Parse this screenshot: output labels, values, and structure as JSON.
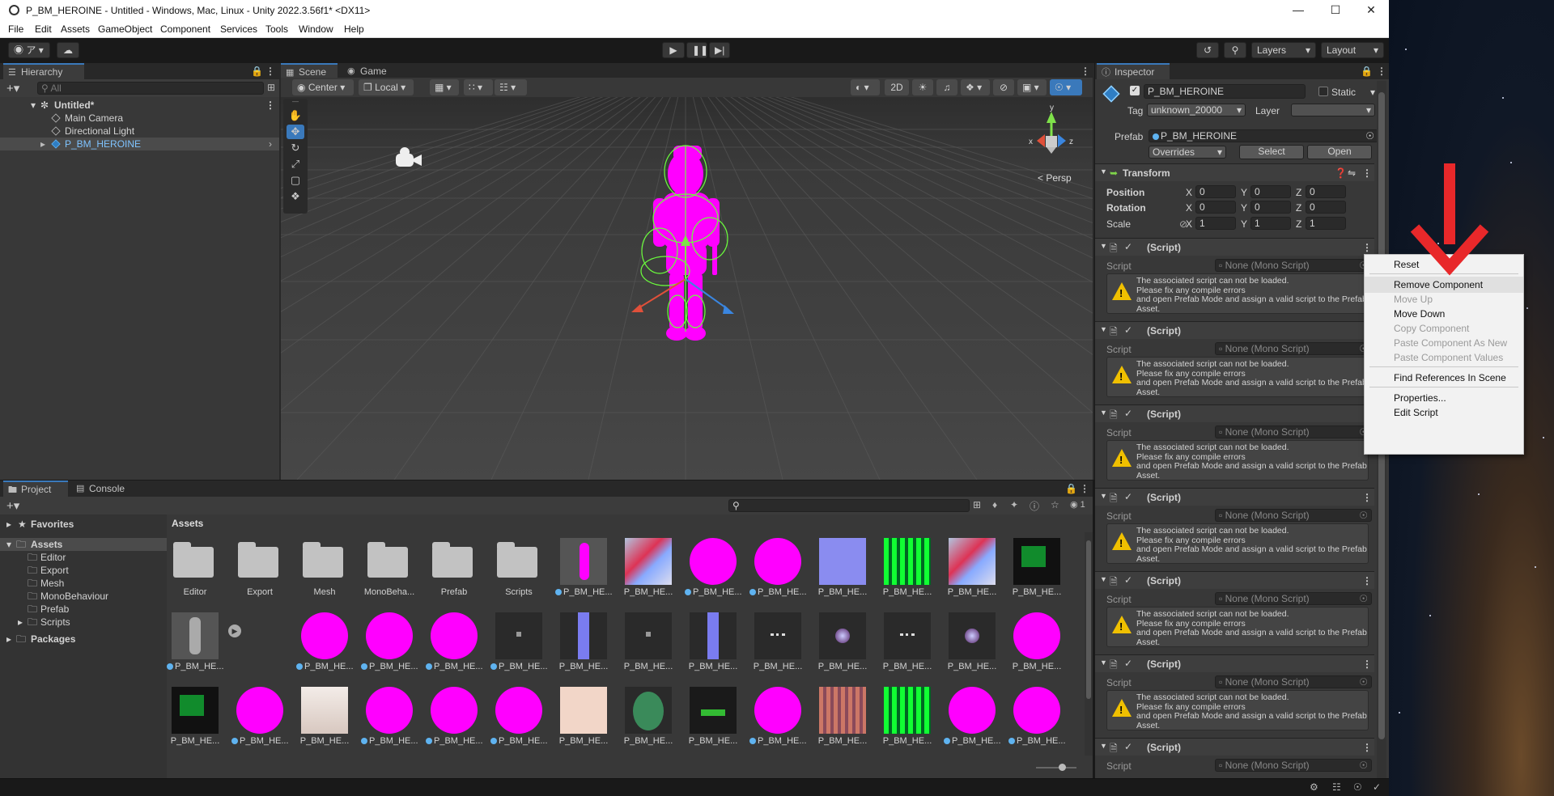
{
  "window": {
    "title": "P_BM_HEROINE - Untitled - Windows, Mac, Linux - Unity 2022.3.56f1* <DX11>"
  },
  "menu": [
    "File",
    "Edit",
    "Assets",
    "GameObject",
    "Component",
    "Services",
    "Tools",
    "Window",
    "Help"
  ],
  "toolbar": {
    "account_label": "ア",
    "layers_label": "Layers",
    "layout_label": "Layout"
  },
  "hierarchy": {
    "tab": "Hierarchy",
    "search_placeholder": "All",
    "scene_name": "Untitled*",
    "items": [
      "Main Camera",
      "Directional Light",
      "P_BM_HEROINE"
    ]
  },
  "scene": {
    "tabs": [
      "Scene",
      "Game"
    ],
    "pivot": "Center",
    "space": "Local",
    "mode_2d": "2D",
    "persp_label": "Persp",
    "axes": [
      "y",
      "x",
      "z"
    ]
  },
  "inspector": {
    "tab": "Inspector",
    "object_name": "P_BM_HEROINE",
    "static_label": "Static",
    "tag_label": "Tag",
    "tag_value": "unknown_20000",
    "layer_label": "Layer",
    "layer_value": "",
    "prefab_label": "Prefab",
    "prefab_value": "P_BM_HEROINE",
    "overrides_label": "Overrides",
    "select_label": "Select",
    "open_label": "Open",
    "transform": {
      "title": "Transform",
      "position_label": "Position",
      "rotation_label": "Rotation",
      "scale_label": "Scale",
      "axis_labels": [
        "X",
        "Y",
        "Z"
      ],
      "position": [
        "0",
        "0",
        "0"
      ],
      "rotation": [
        "0",
        "0",
        "0"
      ],
      "scale": [
        "1",
        "1",
        "1"
      ]
    },
    "components": [
      {
        "title": "(Script)",
        "script_label": "Script",
        "script_value": "None (Mono Script)",
        "warning": "The associated script can not be loaded.\nPlease fix any compile errors\nand open Prefab Mode and assign a valid script to the Prefab\nAsset."
      },
      {
        "title": "(Script)",
        "script_label": "Script",
        "script_value": "None (Mono Script)",
        "warning": "The associated script can not be loaded.\nPlease fix any compile errors\nand open Prefab Mode and assign a valid script to the Prefab\nAsset."
      },
      {
        "title": "(Script)",
        "script_label": "Script",
        "script_value": "None (Mono Script)",
        "warning": "The associated script can not be loaded.\nPlease fix any compile errors\nand open Prefab Mode and assign a valid script to the Prefab\nAsset."
      },
      {
        "title": "(Script)",
        "script_label": "Script",
        "script_value": "None (Mono Script)",
        "warning": "The associated script can not be loaded.\nPlease fix any compile errors\nand open Prefab Mode and assign a valid script to the Prefab\nAsset."
      },
      {
        "title": "(Script)",
        "script_label": "Script",
        "script_value": "None (Mono Script)",
        "warning": "The associated script can not be loaded.\nPlease fix any compile errors\nand open Prefab Mode and assign a valid script to the Prefab\nAsset."
      },
      {
        "title": "(Script)",
        "script_label": "Script",
        "script_value": "None (Mono Script)",
        "warning": "The associated script can not be loaded.\nPlease fix any compile errors\nand open Prefab Mode and assign a valid script to the Prefab\nAsset."
      },
      {
        "title": "(Script)",
        "script_label": "Script",
        "script_value": "None (Mono Script)",
        "warning": ""
      }
    ]
  },
  "context_menu": {
    "items": [
      {
        "label": "Reset",
        "disabled": false
      },
      {
        "label": "Remove Component",
        "disabled": false,
        "highlighted": true
      },
      {
        "label": "Move Up",
        "disabled": true
      },
      {
        "label": "Move Down",
        "disabled": false
      },
      {
        "label": "Copy Component",
        "disabled": true
      },
      {
        "label": "Paste Component As New",
        "disabled": true
      },
      {
        "label": "Paste Component Values",
        "disabled": true
      },
      {
        "label": "Find References In Scene",
        "disabled": false
      },
      {
        "label": "Properties...",
        "disabled": false
      },
      {
        "label": "Edit Script",
        "disabled": false
      }
    ]
  },
  "project": {
    "tabs": [
      "Project",
      "Console"
    ],
    "favorites_label": "Favorites",
    "assets_label": "Assets",
    "folders": [
      "Editor",
      "Export",
      "Mesh",
      "MonoBehaviour",
      "Prefab",
      "Scripts"
    ],
    "packages_label": "Packages",
    "breadcrumb": "Assets",
    "hidden_count": "1",
    "grid_row1": [
      "Editor",
      "Export",
      "Mesh",
      "MonoBeha...",
      "Prefab",
      "Scripts",
      "P_BM_HE...",
      "P_BM_HE...",
      "P_BM_HE...",
      "P_BM_HE...",
      "P_BM_HE...",
      "P_BM_HE...",
      "P_BM_HE...",
      "P_BM_HE..."
    ],
    "grid_row2": [
      "P_BM_HE...",
      "P_BM_HE...",
      "P_BM_HE...",
      "P_BM_HE...",
      "P_BM_HE...",
      "P_BM_HE...",
      "P_BM_HE...",
      "P_BM_HE...",
      "P_BM_HE...",
      "P_BM_HE...",
      "P_BM_HE...",
      "P_BM_HE...",
      "P_BM_HE..."
    ],
    "grid_row3": [
      "P_BM_HE...",
      "P_BM_HE...",
      "P_BM_HE...",
      "P_BM_HE...",
      "P_BM_HE...",
      "P_BM_HE...",
      "P_BM_HE...",
      "P_BM_HE...",
      "P_BM_HE...",
      "P_BM_HE...",
      "P_BM_HE...",
      "P_BM_HE...",
      "P_BM_HE...",
      "P_BM_HE..."
    ]
  },
  "colors": {
    "accent": "#3a79bb",
    "magenta": "#ff00ff",
    "annotation_arrow": "#e8282a",
    "warning": "#f0c000"
  }
}
